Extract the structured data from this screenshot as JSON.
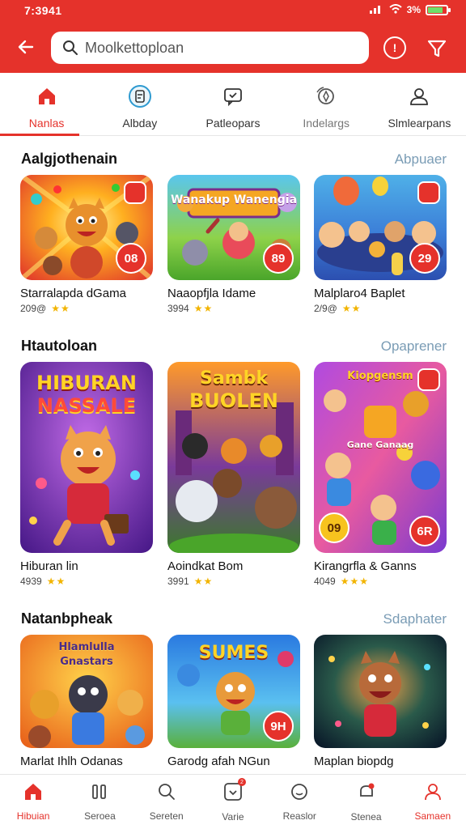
{
  "status": {
    "time": "7:3941",
    "battery": "3%"
  },
  "search": {
    "value": "Moolkettoploan"
  },
  "tabs": [
    {
      "label": "Nanlas",
      "icon": "home-icon"
    },
    {
      "label": "Albday",
      "icon": "clipboard-icon"
    },
    {
      "label": "Patleopars",
      "icon": "chat-icon"
    },
    {
      "label": "Indelargs",
      "icon": "compass-icon"
    },
    {
      "label": "Slmlearpans",
      "icon": "user-icon"
    }
  ],
  "sections": [
    {
      "title": "Aalgjothenain",
      "link": "Abpuaer",
      "cards": [
        {
          "name": "Starralapda dGama",
          "rating": "209@",
          "badge": "08",
          "art": "fox-party"
        },
        {
          "name": "Naaopfjla Idame",
          "rating": "3994",
          "badge": "89",
          "art": "animals-adventure",
          "art_title": "Wanakup Wanengia"
        },
        {
          "name": "Malplaro4 Baplet",
          "rating": "2/9@",
          "badge": "29",
          "art": "kids-park"
        }
      ]
    },
    {
      "title": "Htautoloan",
      "link": "Opaprener",
      "cards": [
        {
          "name": "Hiburan lin",
          "rating": "4939",
          "art": "hiburan-fox",
          "art_title_1": "HIBURAN",
          "art_title_2": "NASSALE"
        },
        {
          "name": "Aoindkat Bom",
          "rating": "3991",
          "art": "sambk-animals",
          "art_title_1": "Sambk",
          "art_title_2": "BUOLEN"
        },
        {
          "name": "Kirangrfla & Ganns",
          "rating": "4049",
          "badge": "6R",
          "badge2": "09",
          "art": "kids-games",
          "art_title_1": "Kiopgensm",
          "art_title_2": "Gane Ganaag"
        }
      ]
    },
    {
      "title": "Natanbpheak",
      "link": "Sdaphater",
      "cards": [
        {
          "name": "Marlat Ihlh Odanas",
          "art": "ghost-party",
          "art_title_1": "Hlamlulla",
          "art_title_2": "Gnastars"
        },
        {
          "name": "Garodg afah NGun",
          "badge": "9H",
          "art": "sumes-cub",
          "art_title_1": "SUMES"
        },
        {
          "name": "Maplan biopdg",
          "art": "wolf-sparkle"
        }
      ]
    }
  ],
  "bottom_nav": [
    {
      "label": "Hibuian",
      "icon": "home-icon"
    },
    {
      "label": "Seroea",
      "icon": "bars-icon"
    },
    {
      "label": "Sereten",
      "icon": "search-icon"
    },
    {
      "label": "Varie",
      "icon": "download-icon",
      "badge": "2"
    },
    {
      "label": "Reaslor",
      "icon": "smile-icon"
    },
    {
      "label": "Stenea",
      "icon": "bell-icon"
    },
    {
      "label": "Samaen",
      "icon": "profile-icon"
    }
  ],
  "colors": {
    "accent": "#e5322b",
    "link": "#7a9cb5",
    "star": "#f2b400"
  }
}
